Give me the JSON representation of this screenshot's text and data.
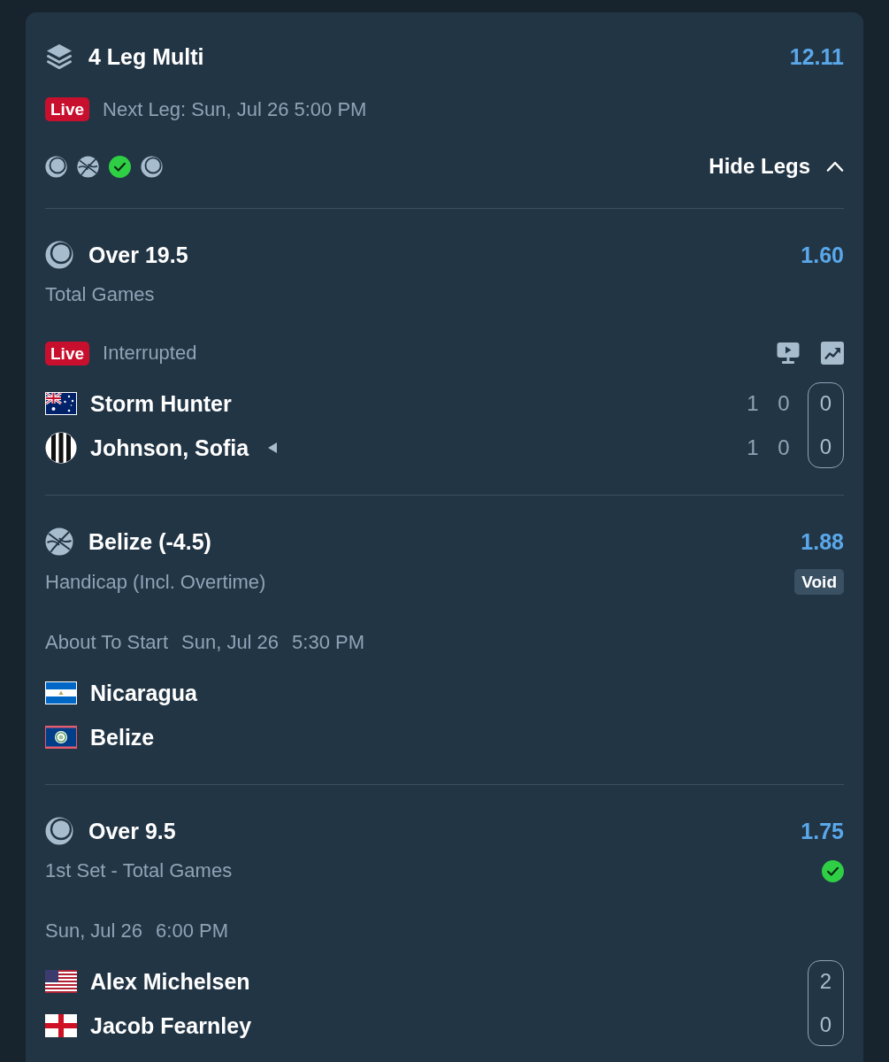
{
  "bet": {
    "title": "4 Leg Multi",
    "odds": "12.11",
    "badge": "Live",
    "next_leg": "Next Leg: Sun, Jul 26 5:00 PM",
    "leg_icons": [
      {
        "kind": "tennis"
      },
      {
        "kind": "basketball"
      },
      {
        "kind": "won"
      },
      {
        "kind": "tennis"
      }
    ],
    "toggle": {
      "label": "Hide Legs",
      "expanded": true
    }
  },
  "legs": [
    {
      "kind": "tennis",
      "selection": "Over 19.5",
      "odds": "1.60",
      "market": "Total Games",
      "badge": "Live",
      "status": "Interrupted",
      "tools": [
        {
          "kind": "stream"
        },
        {
          "kind": "stats"
        }
      ],
      "participants": [
        {
          "name": "Storm Hunter",
          "flag": {
            "kind": "australia"
          },
          "serving": false,
          "scores": [
            "1",
            "0"
          ],
          "current": "0"
        },
        {
          "name": "Johnson, Sofia",
          "flag": {
            "kind": "striped"
          },
          "serving": true,
          "scores": [
            "1",
            "0"
          ],
          "current": "0"
        }
      ]
    },
    {
      "kind": "basketball",
      "selection": "Belize (-4.5)",
      "odds": "1.88",
      "market": "Handicap (Incl. Overtime)",
      "result": {
        "kind": "void",
        "label": "Void"
      },
      "status": "About To Start",
      "date": "Sun, Jul 26",
      "time": "5:30 PM",
      "participants": [
        {
          "name": "Nicaragua",
          "flag": {
            "kind": "nicaragua"
          }
        },
        {
          "name": "Belize",
          "flag": {
            "kind": "belize"
          }
        }
      ]
    },
    {
      "kind": "tennis",
      "selection": "Over 9.5",
      "odds": "1.75",
      "market": "1st Set - Total Games",
      "result": {
        "kind": "won"
      },
      "date": "Sun, Jul 26",
      "time": "6:00 PM",
      "participants": [
        {
          "name": "Alex Michelsen",
          "flag": {
            "kind": "usa"
          },
          "current": "2"
        },
        {
          "name": "Jacob Fearnley",
          "flag": {
            "kind": "england"
          },
          "current": "0"
        }
      ]
    }
  ]
}
